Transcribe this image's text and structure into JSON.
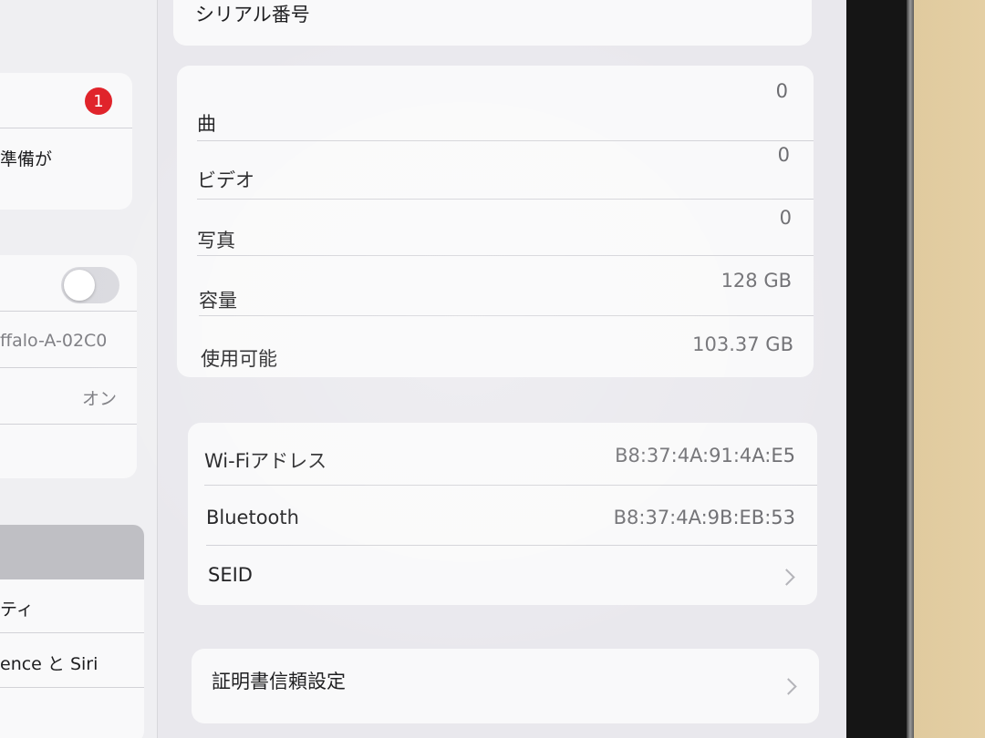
{
  "header": {
    "serial_label": "シリアル番号"
  },
  "sidebar": {
    "badge_count": "1",
    "update_text": "準備が",
    "wifi_network": "ffalo-A-02C0",
    "bluetooth_status": "オン",
    "item_accessibility": "ティ",
    "item_siri": "ence と Siri"
  },
  "media": {
    "songs_label": "曲",
    "songs_value": "0",
    "videos_label": "ビデオ",
    "videos_value": "0",
    "photos_label": "写真",
    "photos_value": "0",
    "capacity_label": "容量",
    "capacity_value": "128 GB",
    "available_label": "使用可能",
    "available_value": "103.37 GB"
  },
  "network": {
    "wifi_label": "Wi-Fiアドレス",
    "wifi_value": "B8:37:4A:91:4A:E5",
    "bluetooth_label": "Bluetooth",
    "bluetooth_value": "B8:37:4A:9B:EB:53",
    "seid_label": "SEID"
  },
  "certificates": {
    "trust_label": "証明書信頼設定"
  },
  "colors": {
    "badge": "#e0242b",
    "screen_bg": "#e9e8ed",
    "card_bg": "#f9f9fa"
  }
}
